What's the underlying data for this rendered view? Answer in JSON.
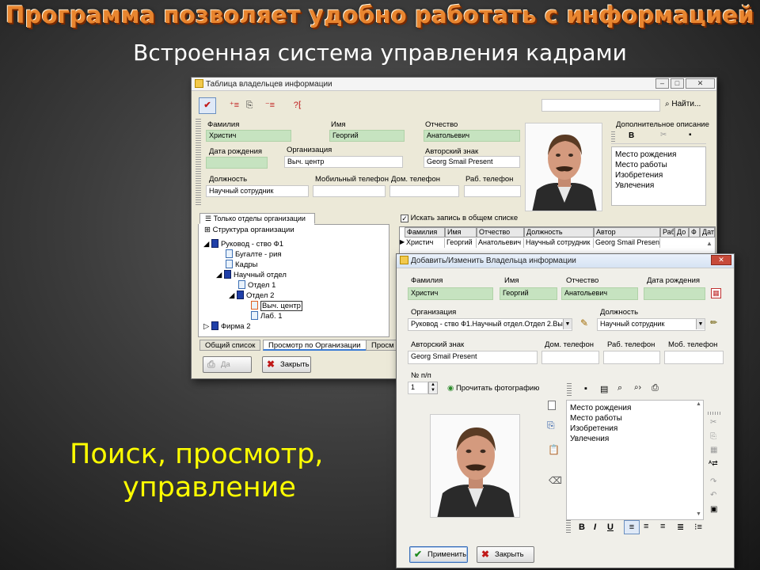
{
  "slide": {
    "title": "Программа позволяет удобно работать с информацией",
    "subtitle": "Встроенная система управления кадрами",
    "caption_line1": "Поиск, просмотр,",
    "caption_line2": "управление"
  },
  "owners_window": {
    "title": "Таблица владельцев информации",
    "search_value": "",
    "find_label": "Найти...",
    "fields": {
      "lastname_label": "Фамилия",
      "lastname_value": "Христич",
      "firstname_label": "Имя",
      "firstname_value": "Георгий",
      "patronymic_label": "Отчество",
      "patronymic_value": "Анатольевич",
      "birthdate_label": "Дата рождения",
      "birthdate_value": "",
      "org_label": "Организация",
      "org_value": "Выч. центр",
      "author_label": "Авторский знак",
      "author_value": "Georg Smail Present",
      "position_label": "Должность",
      "position_value": "Научный сотрудник",
      "mobile_label": "Мобильный телефон",
      "mobile_value": "",
      "home_phone_label": "Дом. телефон",
      "home_phone_value": "",
      "work_phone_label": "Раб. телефон",
      "work_phone_value": ""
    },
    "extra_desc_label": "Дополнительное описание",
    "extra_desc_items": [
      "Место рождения",
      "Место работы",
      "Изобретения",
      "Увлечения"
    ],
    "org_only_tab": "Только отделы организации",
    "structure_tab": "Структура организации",
    "tree": [
      {
        "label": "Руковод - ство Ф1",
        "kind": "org"
      },
      {
        "label": "Бугалте - рия",
        "kind": "doc"
      },
      {
        "label": "Кадры",
        "kind": "doc"
      },
      {
        "label": "Научный отдел",
        "kind": "org"
      },
      {
        "label": "Отдел 1",
        "kind": "doc"
      },
      {
        "label": "Отдел 2",
        "kind": "org"
      },
      {
        "label": "Выч. центр",
        "kind": "doc"
      },
      {
        "label": "Лаб. 1",
        "kind": "doc"
      },
      {
        "label": "Фирма 2",
        "kind": "org"
      }
    ],
    "search_all_label": "Искать запись в общем списке",
    "grid_headers": [
      "Фамилия",
      "Имя",
      "Отчество",
      "Должность",
      "Автор",
      "Раб",
      "До",
      "Ф",
      "Дат"
    ],
    "grid_row": [
      "Христич",
      "Георгий",
      "Анатольевич",
      "Научный сотрудник",
      "Georg Smail Present",
      "",
      "",
      "",
      ""
    ],
    "bottom_tabs": [
      "Общий список",
      "Просмотр по Организации",
      "Просм"
    ],
    "yes_button": "Да",
    "close_button": "Закрыть"
  },
  "edit_window": {
    "title": "Добавить/Изменить Владельца информации",
    "lastname_label": "Фамилия",
    "lastname_value": "Христич",
    "firstname_label": "Имя",
    "firstname_value": "Георгий",
    "patronymic_label": "Отчество",
    "patronymic_value": "Анатольевич",
    "birthdate_label": "Дата рождения",
    "birthdate_value": "",
    "org_label": "Организация",
    "org_value": "Руковод - ство Ф1.Научный отдел.Отдел 2.Вы",
    "position_label": "Должность",
    "position_value": "Научный сотрудник",
    "author_label": "Авторский знак",
    "author_value": "Georg Smail Present",
    "home_phone_label": "Дом. телефон",
    "home_phone_value": "",
    "work_phone_label": "Раб. телефон",
    "work_phone_value": "",
    "mobile_label": "Моб. телефон",
    "mobile_value": "",
    "number_label": "№ п/п",
    "number_value": "1",
    "read_photo_label": "Прочитать фотографию",
    "memo_items": [
      "Место рождения",
      "Место работы",
      "Изобретения",
      "Увлечения"
    ],
    "apply_button": "Применить",
    "close_button": "Закрыть"
  },
  "colors": {
    "title_orange": "#e8852f",
    "caption_yellow": "#ffff00",
    "field_green": "#c6e3c0"
  }
}
